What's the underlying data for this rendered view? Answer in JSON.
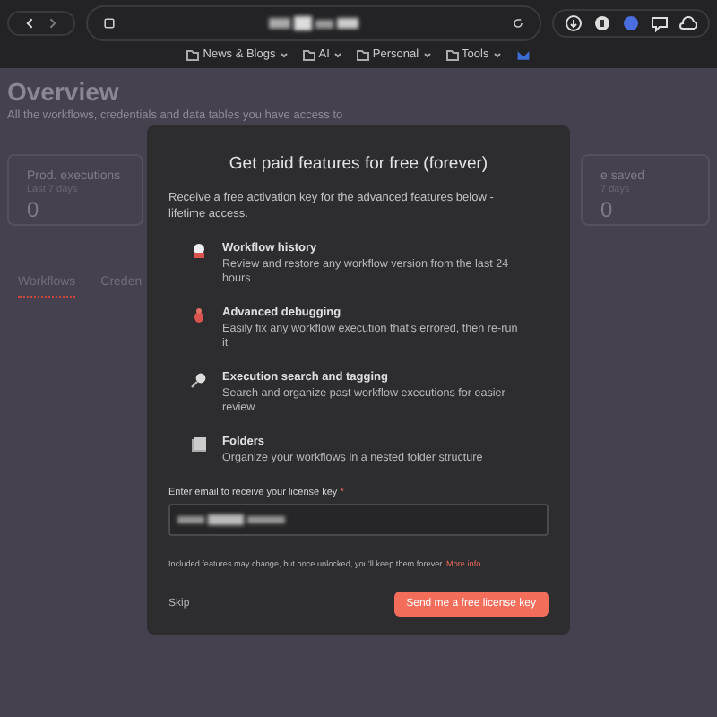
{
  "browser": {
    "bookmarks": [
      {
        "label": "News & Blogs"
      },
      {
        "label": "AI"
      },
      {
        "label": "Personal"
      },
      {
        "label": "Tools"
      }
    ]
  },
  "page": {
    "title": "Overview",
    "subtitle": "All the workflows, credentials and data tables you have access to",
    "cards": [
      {
        "label": "Prod. executions",
        "period": "Last 7 days",
        "value": "0"
      },
      {
        "label": "e saved",
        "period": "7 days",
        "value": "0"
      }
    ],
    "tabs": [
      {
        "label": "Workflows",
        "selected": true
      },
      {
        "label": "Creden",
        "selected": false
      }
    ]
  },
  "modal": {
    "title": "Get paid features for free (forever)",
    "intro": "Receive a free activation key for the advanced features below - lifetime access.",
    "features": [
      {
        "kind": "history",
        "title": "Workflow history",
        "text": "Review and restore any workflow version from the last 24 hours"
      },
      {
        "kind": "debug",
        "title": "Advanced debugging",
        "text": "Easily fix any workflow execution that’s errored, then re-run it"
      },
      {
        "kind": "search",
        "title": "Execution search and tagging",
        "text": "Search and organize past workflow executions for easier review"
      },
      {
        "kind": "folder",
        "title": "Folders",
        "text": "Organize your workflows in a nested folder structure"
      }
    ],
    "email_label": "Enter email to receive your license key",
    "required_mark": "*",
    "note": "Included features may change, but once unlocked, you’ll keep them forever.",
    "note_link": "More info",
    "skip": "Skip",
    "submit": "Send me a free license key"
  }
}
